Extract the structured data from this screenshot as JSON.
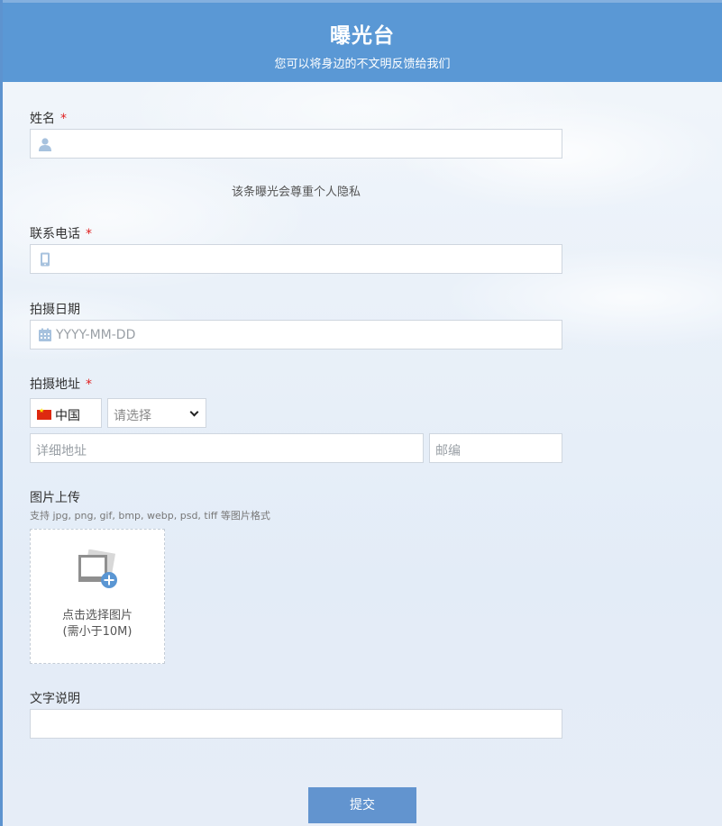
{
  "header": {
    "title": "曝光台",
    "subtitle": "您可以将身边的不文明反馈给我们"
  },
  "name_field": {
    "label": "姓名",
    "required_mark": "*",
    "icon": "user-icon",
    "value": ""
  },
  "privacy_note": "该条曝光会尊重个人隐私",
  "phone_field": {
    "label": "联系电话",
    "required_mark": "*",
    "icon": "mobile-phone-icon",
    "value": ""
  },
  "date_field": {
    "label": "拍摄日期",
    "icon": "calendar-icon",
    "placeholder": "YYYY-MM-DD"
  },
  "address_field": {
    "label": "拍摄地址",
    "required_mark": "*",
    "country": "中国",
    "country_flag": "china-flag-icon",
    "region_select": "请选择",
    "detail_placeholder": "详细地址",
    "postcode_placeholder": "邮编"
  },
  "upload_field": {
    "label": "图片上传",
    "formats_note": "支持 jpg, png, gif, bmp, webp, psd, tiff 等图片格式",
    "icon": "add-image-icon",
    "button_line1": "点击选择图片",
    "button_line2": "(需小于10M)"
  },
  "description_field": {
    "label": "文字说明",
    "value": ""
  },
  "submit_label": "提交",
  "colors": {
    "header_bg": "#5a98d5",
    "submit_bg": "#6294cf",
    "required": "#e02020",
    "icon": "#a7c2de"
  }
}
